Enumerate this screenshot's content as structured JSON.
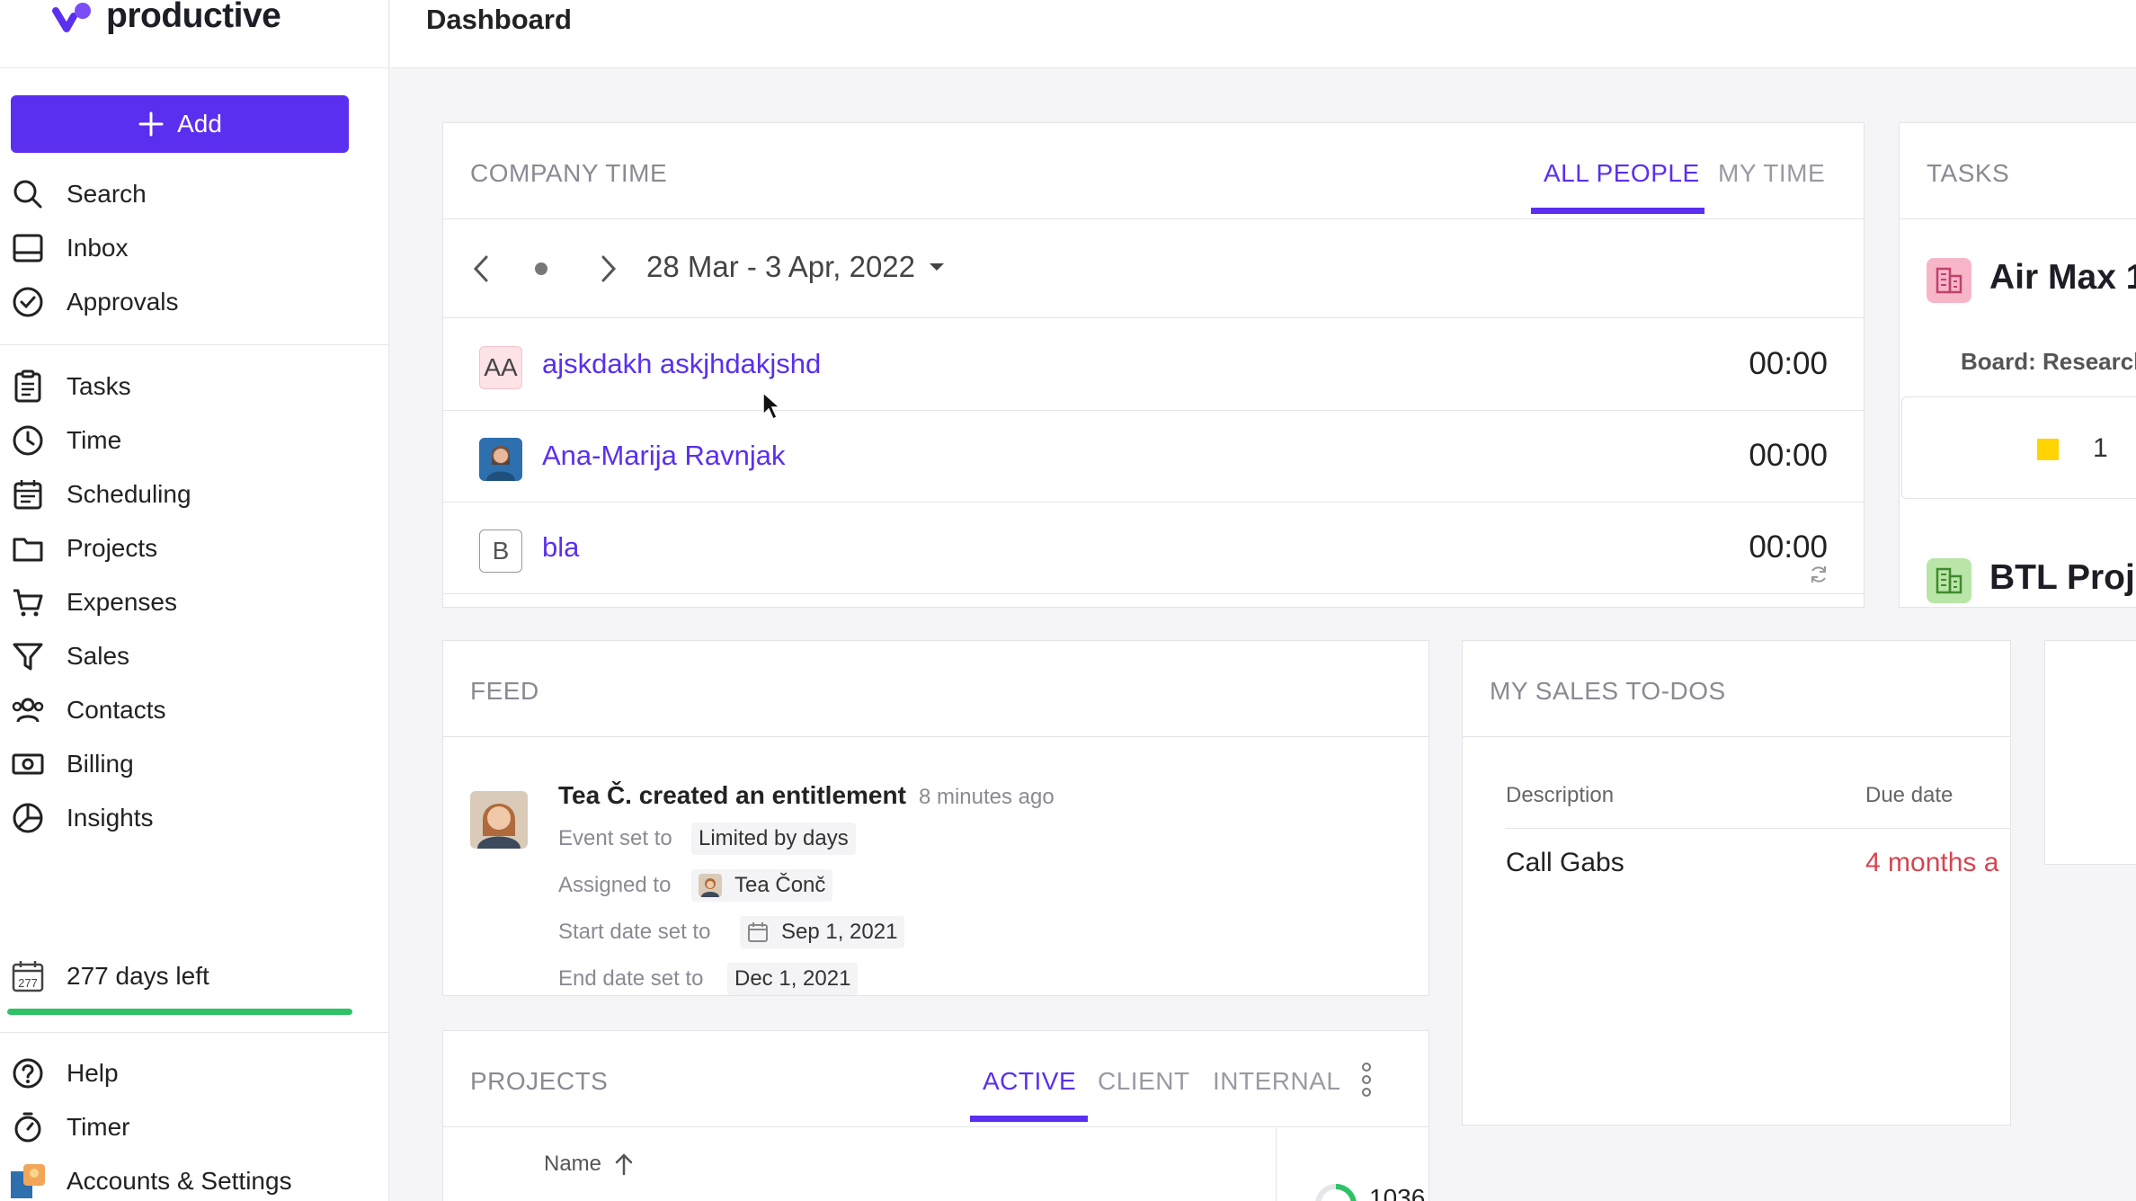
{
  "app": {
    "logo_text": "productive",
    "page_title": "Dashboard"
  },
  "sidebar": {
    "add_label": "Add",
    "top_items": [
      {
        "label": "Search",
        "icon": "search-icon"
      },
      {
        "label": "Inbox",
        "icon": "inbox-icon"
      },
      {
        "label": "Approvals",
        "icon": "approvals-icon"
      }
    ],
    "main_items": [
      {
        "label": "Tasks",
        "icon": "tasks-icon"
      },
      {
        "label": "Time",
        "icon": "clock-icon"
      },
      {
        "label": "Scheduling",
        "icon": "calendar-icon"
      },
      {
        "label": "Projects",
        "icon": "folder-icon"
      },
      {
        "label": "Expenses",
        "icon": "cart-icon"
      },
      {
        "label": "Sales",
        "icon": "funnel-icon"
      },
      {
        "label": "Contacts",
        "icon": "contacts-icon"
      },
      {
        "label": "Billing",
        "icon": "billing-icon"
      },
      {
        "label": "Insights",
        "icon": "insights-icon"
      }
    ],
    "trial": {
      "icon_text": "277",
      "label": "277 days left",
      "progress": 1.0
    },
    "bottom_items": [
      {
        "label": "Help",
        "icon": "help-icon"
      },
      {
        "label": "Timer",
        "icon": "stopwatch-icon"
      },
      {
        "label": "Accounts & Settings",
        "icon": "account-avatar-icon"
      }
    ]
  },
  "company_time": {
    "title": "COMPANY TIME",
    "tabs": [
      "ALL PEOPLE",
      "MY TIME"
    ],
    "active_tab": "ALL PEOPLE",
    "date_range": "28 Mar - 3 Apr, 2022",
    "rows": [
      {
        "initials": "AA",
        "name": "ajskdakh askjhdakjshd",
        "time": "00:00",
        "avatar_color": "#fde2e6"
      },
      {
        "initials": "",
        "name": "Ana-Marija Ravnjak",
        "time": "00:00",
        "avatar_color": "#2e6fae"
      },
      {
        "initials": "B",
        "name": "bla",
        "time": "00:00",
        "avatar_color": "#ffffff"
      }
    ]
  },
  "tasks": {
    "title": "TASKS",
    "items": [
      {
        "title": "Air Max 1",
        "board": "Board: Research",
        "count": "1",
        "icon_color": "#f7b6c8"
      },
      {
        "title": "BTL Proj",
        "icon_color": "#b9e6a8"
      }
    ]
  },
  "feed": {
    "title": "FEED",
    "entry": {
      "actor": "Tea Č. created an entitlement",
      "time_ago": "8 minutes ago",
      "fields": [
        {
          "label": "Event set to",
          "value": "Limited by days"
        },
        {
          "label": "Assigned to",
          "value": "Tea Čonč"
        },
        {
          "label": "Start date set to",
          "value": "Sep 1, 2021"
        },
        {
          "label": "End date set to",
          "value": "Dec 1, 2021"
        }
      ]
    }
  },
  "sales_todos": {
    "title": "MY SALES TO-DOS",
    "columns": [
      "Description",
      "Due date"
    ],
    "rows": [
      {
        "description": "Call Gabs",
        "due": "4 months a"
      }
    ]
  },
  "projects": {
    "title": "PROJECTS",
    "tabs": [
      "ACTIVE",
      "CLIENT",
      "INTERNAL"
    ],
    "active_tab": "ACTIVE",
    "column_name": "Name",
    "partial_number": "1036"
  },
  "colors": {
    "accent": "#5a2ff0",
    "overdue": "#d64550",
    "progress": "#2ec266"
  }
}
